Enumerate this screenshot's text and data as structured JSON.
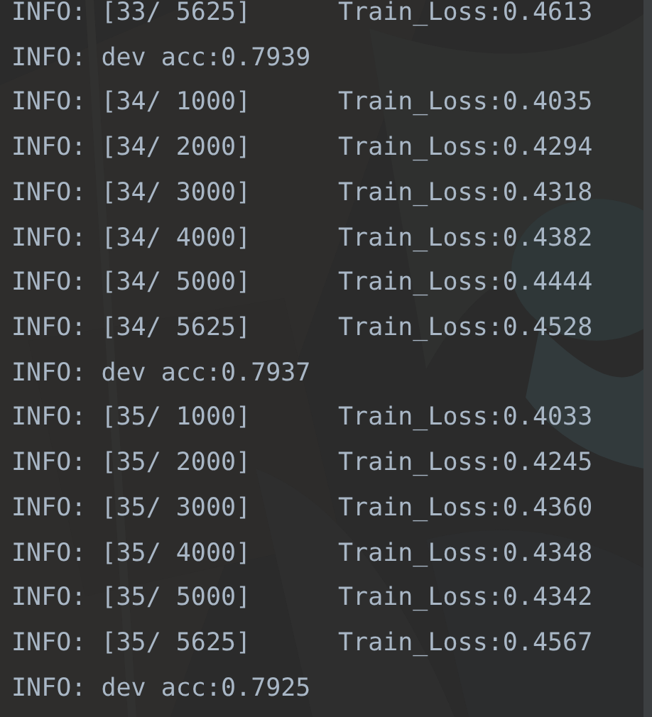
{
  "console": {
    "lines": [
      {
        "kind": "step",
        "text": "INFO: [33/ 5625]",
        "loss": "Train_Loss:0.4613"
      },
      {
        "kind": "dev",
        "text": "INFO: dev acc:0.7939"
      },
      {
        "kind": "step",
        "text": "INFO: [34/ 1000]",
        "loss": "Train_Loss:0.4035"
      },
      {
        "kind": "step",
        "text": "INFO: [34/ 2000]",
        "loss": "Train_Loss:0.4294"
      },
      {
        "kind": "step",
        "text": "INFO: [34/ 3000]",
        "loss": "Train_Loss:0.4318"
      },
      {
        "kind": "step",
        "text": "INFO: [34/ 4000]",
        "loss": "Train_Loss:0.4382"
      },
      {
        "kind": "step",
        "text": "INFO: [34/ 5000]",
        "loss": "Train_Loss:0.4444"
      },
      {
        "kind": "step",
        "text": "INFO: [34/ 5625]",
        "loss": "Train_Loss:0.4528"
      },
      {
        "kind": "dev",
        "text": "INFO: dev acc:0.7937"
      },
      {
        "kind": "step",
        "text": "INFO: [35/ 1000]",
        "loss": "Train_Loss:0.4033"
      },
      {
        "kind": "step",
        "text": "INFO: [35/ 2000]",
        "loss": "Train_Loss:0.4245"
      },
      {
        "kind": "step",
        "text": "INFO: [35/ 3000]",
        "loss": "Train_Loss:0.4360"
      },
      {
        "kind": "step",
        "text": "INFO: [35/ 4000]",
        "loss": "Train_Loss:0.4348"
      },
      {
        "kind": "step",
        "text": "INFO: [35/ 5000]",
        "loss": "Train_Loss:0.4342"
      },
      {
        "kind": "step",
        "text": "INFO: [35/ 5625]",
        "loss": "Train_Loss:0.4567"
      },
      {
        "kind": "dev",
        "text": "INFO: dev acc:0.7925"
      }
    ]
  }
}
